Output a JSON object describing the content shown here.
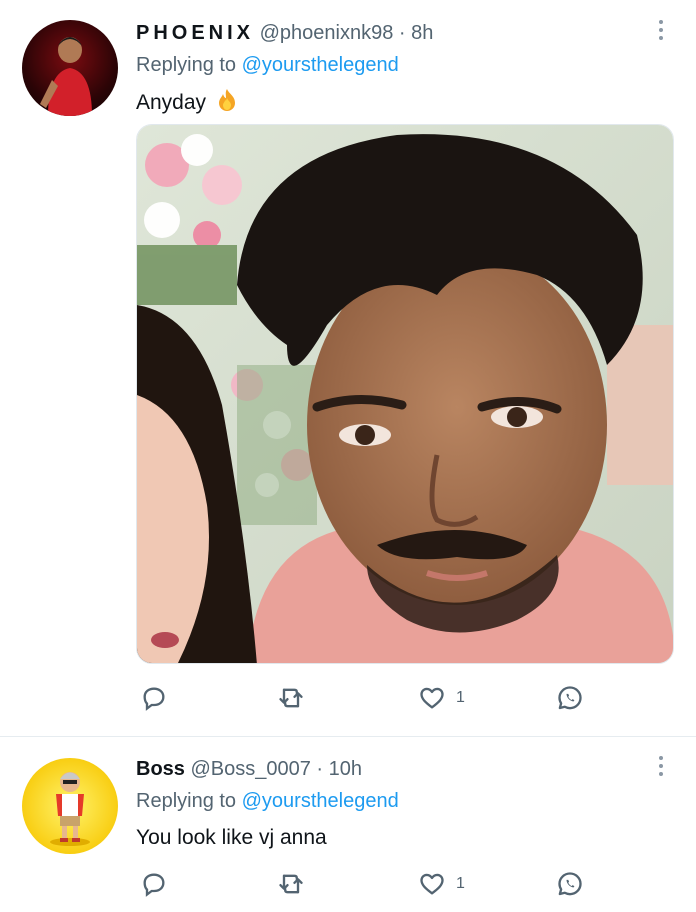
{
  "tweets": [
    {
      "name": "PHOENIX",
      "handle": "@phoenixnk98",
      "time": "· 8h",
      "replying_label": "Replying to",
      "replying_to": "@yoursthelegend",
      "text": "Anyday",
      "emoji": "fire-icon",
      "has_media": true,
      "likes": "1"
    },
    {
      "name": "Boss",
      "handle": "@Boss_0007",
      "time": "· 10h",
      "replying_label": "Replying to",
      "replying_to": "@yoursthelegend",
      "text": "You look like vj anna",
      "has_media": false,
      "likes": "1"
    }
  ],
  "colors": {
    "accent": "#1d9bf0",
    "muted": "#536471",
    "text": "#0f1419"
  }
}
